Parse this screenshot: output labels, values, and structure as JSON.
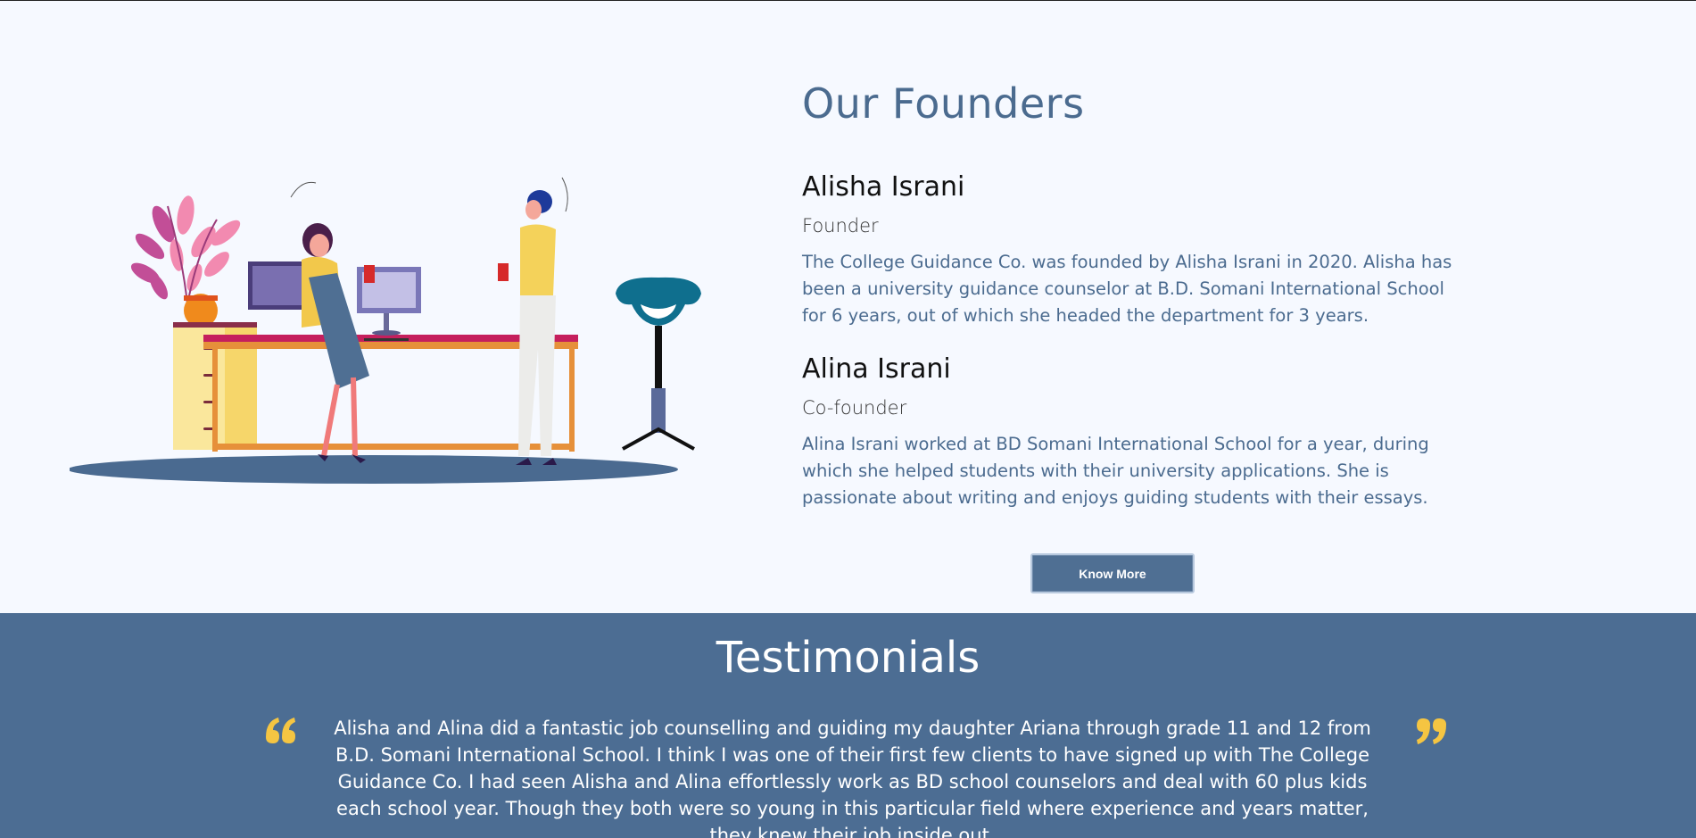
{
  "founders": {
    "title": "Our Founders",
    "people": [
      {
        "name": "Alisha Israni",
        "role": "Founder",
        "bio": "The College Guidance Co. was founded by Alisha Israni in 2020. Alisha has been a university guidance counselor at B.D. Somani International School for 6 years, out of which she headed the department for 3 years."
      },
      {
        "name": "Alina Israni",
        "role": "Co-founder",
        "bio": "Alina Israni worked at BD Somani International School for a year, during which she helped students with their university applications. She is passionate about writing and enjoys guiding students with their essays."
      }
    ],
    "button_label": "Know More"
  },
  "testimonials": {
    "title": "Testimonials",
    "items": [
      {
        "text": "Alisha and Alina did a fantastic job counselling and guiding my daughter Ariana through grade 11 and 12 from B.D. Somani International School. I think I was one of their first few clients to have signed up with The College Guidance Co. I had seen Alisha and Alina effortlessly work as BD school counselors and deal with 60 plus kids each school year. Though they both were so young in this particular field where experience and years matter, they knew their job inside out."
      }
    ]
  },
  "icons": {
    "quote_open": "quote-open-icon",
    "quote_close": "quote-close-icon",
    "illustration": "office-illustration"
  },
  "colors": {
    "accent": "#4c6d93",
    "title": "#4b6b8f",
    "quote": "#f5c542",
    "background": "#f6f9ff"
  }
}
